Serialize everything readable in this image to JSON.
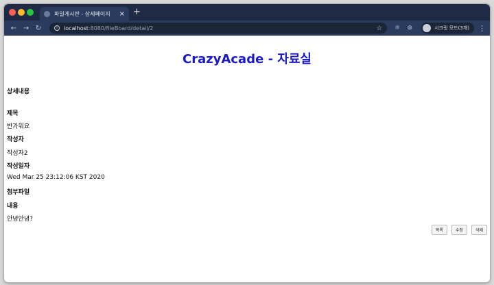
{
  "browser": {
    "tab_title": "파일게시판 - 상세페이지",
    "tab_close": "×",
    "new_tab": "+",
    "url_host": "localhost",
    "url_path": ":8080/fileBoard/detail/2",
    "profile_label": "시크릿 모드(3개)"
  },
  "page": {
    "title": "CrazyAcade - 자료실",
    "section_heading": "상세내용",
    "subject_label": "제목",
    "subject_value": "반가워요",
    "author_label": "작성자",
    "author_value": "작성자2",
    "date_label": "작성일자",
    "date_value": "Wed Mar 25 23:12:06 KST 2020",
    "attachment_label": "첨부파일",
    "content_label": "내용",
    "content_value": "안녕안녕?",
    "buttons": {
      "list": "목록",
      "edit": "수정",
      "delete": "삭제"
    }
  }
}
